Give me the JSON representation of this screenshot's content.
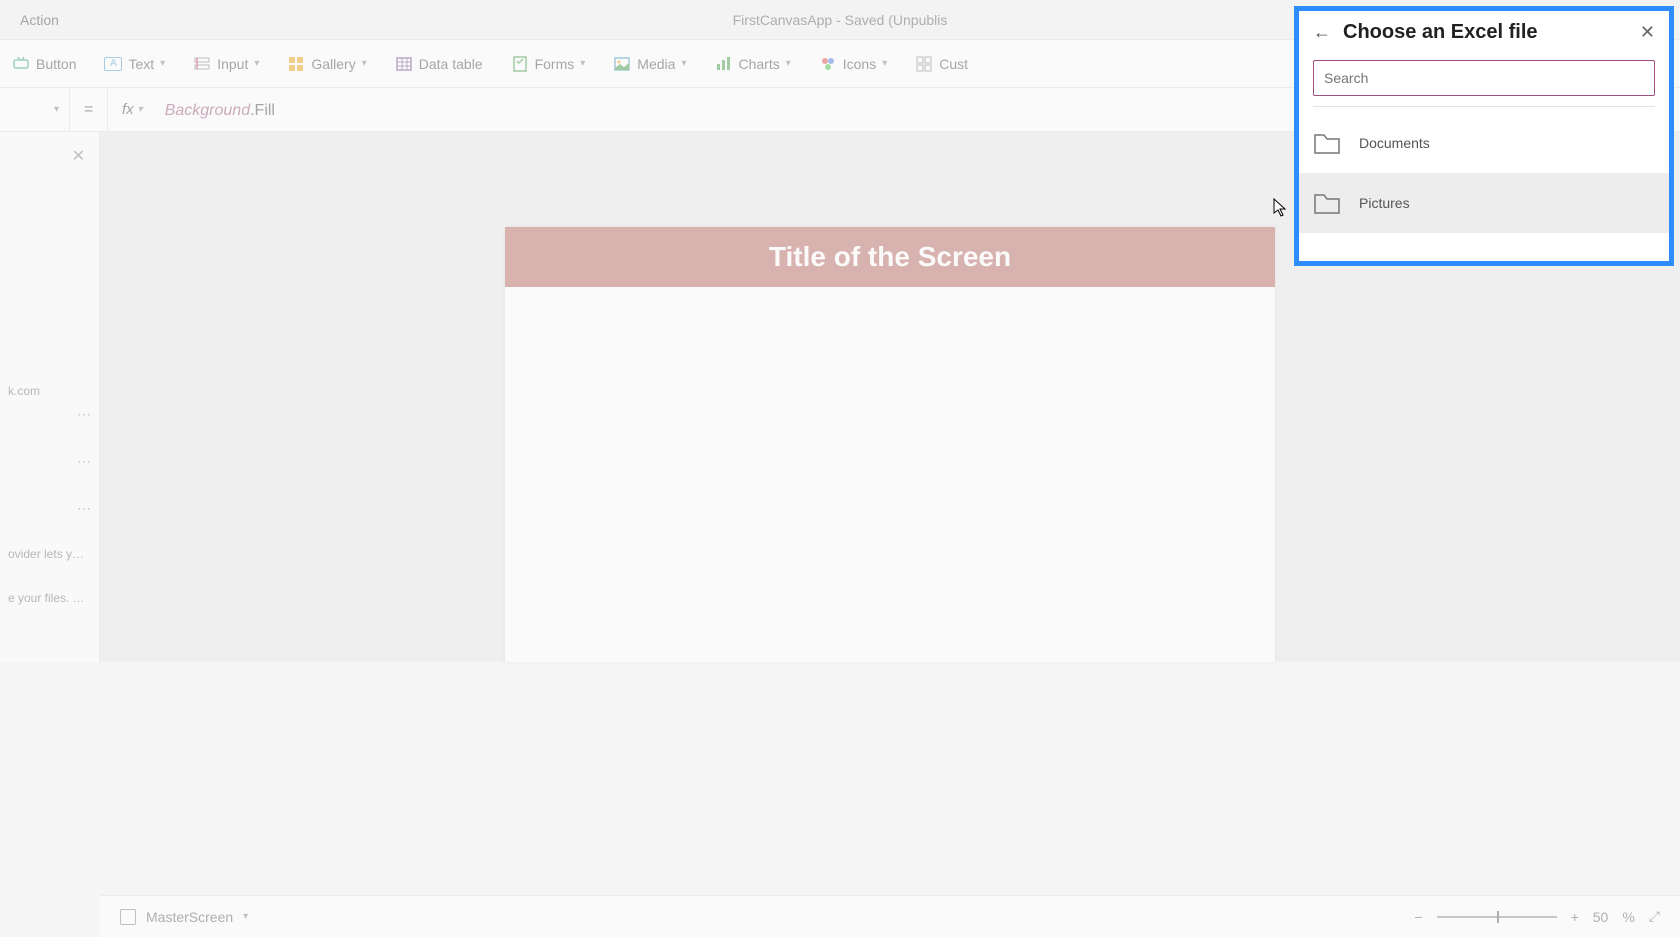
{
  "tab": {
    "action": "Action"
  },
  "appTitle": "FirstCanvasApp - Saved (Unpublis",
  "ribbon": {
    "button": "Button",
    "text": "Text",
    "input": "Input",
    "gallery": "Gallery",
    "dataTable": "Data table",
    "forms": "Forms",
    "media": "Media",
    "charts": "Charts",
    "icons": "Icons",
    "custom": "Cust"
  },
  "formula": {
    "equals": "=",
    "fx": "fx",
    "bg": "Background",
    "fill": ".Fill"
  },
  "leftPanel": {
    "items": [
      "k.com",
      "ovider lets you ...",
      "e your files. Yo..."
    ]
  },
  "canvas": {
    "screenTitle": "Title of the Screen"
  },
  "statusBar": {
    "screenName": "MasterScreen",
    "zoomValue": "50",
    "zoomUnit": "%"
  },
  "rightPanel": {
    "title": "Choose an Excel file",
    "searchPlaceholder": "Search",
    "folders": [
      {
        "name": "Documents"
      },
      {
        "name": "Pictures"
      }
    ]
  }
}
